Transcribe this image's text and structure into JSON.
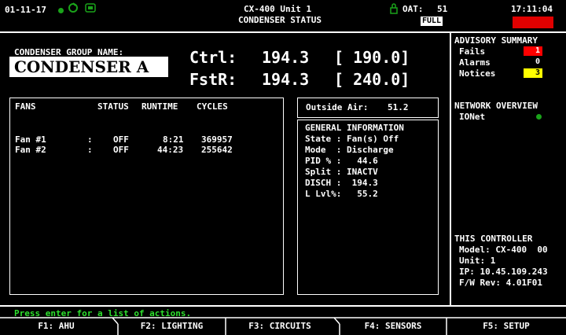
{
  "header": {
    "date": "01-11-17",
    "unit_title": "CX-400 Unit 1",
    "screen_title": "CONDENSER STATUS",
    "oat_label": "OAT:",
    "oat_value": "51",
    "mode_badge": "FULL",
    "time": "17:11:04",
    "alarm_color": "#e00000"
  },
  "group": {
    "label": "CONDENSER GROUP NAME:",
    "name": "CONDENSER A"
  },
  "control": {
    "ctrl_label": "Ctrl:",
    "ctrl_value": "194.3",
    "ctrl_setpoint": "[ 190.0]",
    "fstr_label": "FstR:",
    "fstr_value": "194.3",
    "fstr_setpoint": "[ 240.0]"
  },
  "fans": {
    "headers": [
      "FANS",
      "STATUS",
      "RUNTIME",
      "CYCLES"
    ],
    "rows": [
      {
        "name": "Fan #1",
        "sep": ":",
        "status": "OFF",
        "runtime": "8:21",
        "cycles": "369957"
      },
      {
        "name": "Fan #2",
        "sep": ":",
        "status": "OFF",
        "runtime": "44:23",
        "cycles": "255642"
      }
    ]
  },
  "outside_air": {
    "label": "Outside Air:",
    "value": "51.2"
  },
  "general": {
    "title": "GENERAL INFORMATION",
    "lines": [
      "State : Fan(s) Off",
      "Mode  : Discharge",
      "PID % :   44.6",
      "Split : INACTV",
      "DISCH :  194.3",
      "L Lvl%:   55.2"
    ]
  },
  "advisory": {
    "title": "ADVISORY SUMMARY",
    "items": [
      {
        "label": "Fails",
        "count": "1",
        "color": "#ff0000"
      },
      {
        "label": "Alarms",
        "count": "0",
        "color": "#000000"
      },
      {
        "label": "Notices",
        "count": "3",
        "color": "#ffff00"
      }
    ]
  },
  "network": {
    "title": "NETWORK OVERVIEW",
    "items": [
      {
        "label": "IONet",
        "status_color": "#1aa31a"
      }
    ]
  },
  "controller": {
    "title": "THIS CONTROLLER",
    "lines": [
      "Model: CX-400  00",
      "Unit: 1",
      "IP: 10.45.109.243",
      "F/W Rev: 4.01F01"
    ]
  },
  "prompt": "Press enter for a list of actions.",
  "function_keys": [
    "F1: AHU",
    "F2: LIGHTING",
    "F3: CIRCUITS",
    "F4: SENSORS",
    "F5: SETUP"
  ],
  "colors": {
    "prompt_green": "#2ee02e",
    "status_green": "#1aa31a"
  }
}
